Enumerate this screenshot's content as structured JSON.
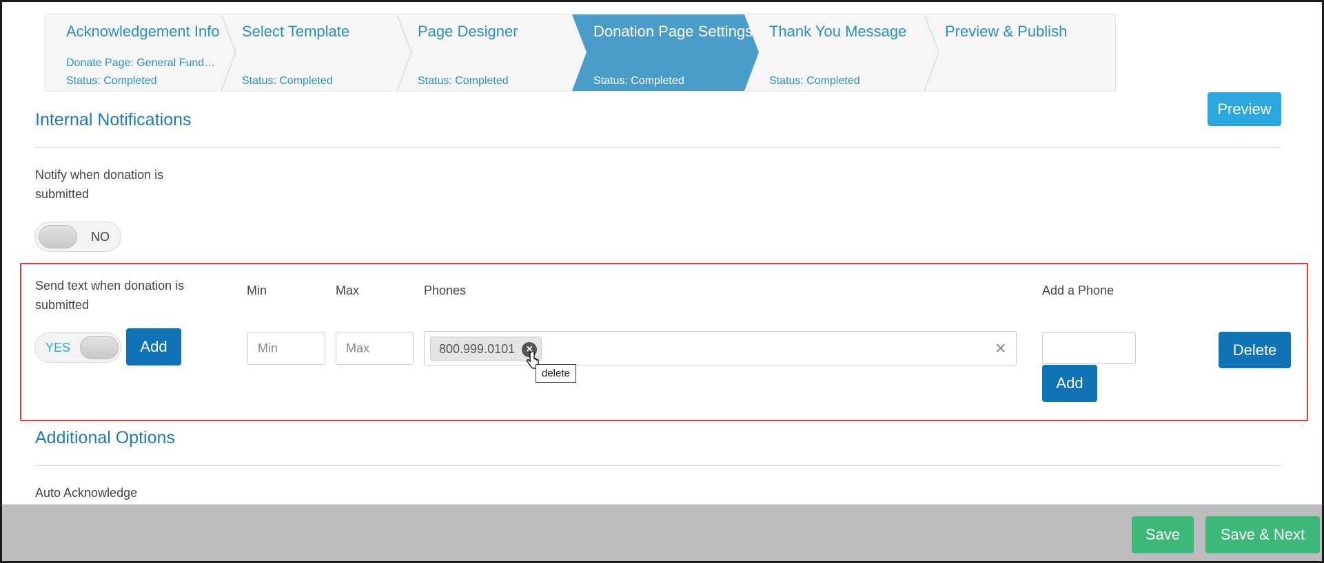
{
  "stepper": {
    "steps": [
      {
        "title": "Acknowledgement Info",
        "sub": "Donate Page: General Fund…",
        "status": "Status: Completed",
        "active": false
      },
      {
        "title": "Select Template",
        "sub": "",
        "status": "Status: Completed",
        "active": false
      },
      {
        "title": "Page Designer",
        "sub": "",
        "status": "Status: Completed",
        "active": false
      },
      {
        "title": "Donation Page Settings",
        "sub": "",
        "status": "Status: Completed",
        "active": true
      },
      {
        "title": "Thank You Message",
        "sub": "",
        "status": "Status: Completed",
        "active": false
      },
      {
        "title": "Preview & Publish",
        "sub": "",
        "status": "",
        "active": false
      }
    ],
    "active_color": "#4a9cc9"
  },
  "preview_label": "Preview",
  "internal_notifications": {
    "title": "Internal Notifications",
    "notify_label": "Notify when donation is submitted",
    "notify_toggle": "NO",
    "text_label": "Send text when donation is submitted",
    "text_toggle": "YES",
    "add_label": "Add",
    "min_label": "Min",
    "max_label": "Max",
    "min_placeholder": "Min",
    "max_placeholder": "Max",
    "phones_label": "Phones",
    "phone_chip": "800.999.0101",
    "chip_tooltip": "delete",
    "add_phone_label": "Add a Phone",
    "add_phone_button": "Add",
    "delete_label": "Delete"
  },
  "additional_options": {
    "title": "Additional Options",
    "auto_ack_label": "Auto Acknowledge"
  },
  "footer": {
    "save_label": "Save",
    "save_next_label": "Save & Next"
  },
  "colors": {
    "primary": "#0f73b6",
    "preview": "#2aa7de",
    "save": "#3cb878",
    "highlight": "#e53935"
  }
}
